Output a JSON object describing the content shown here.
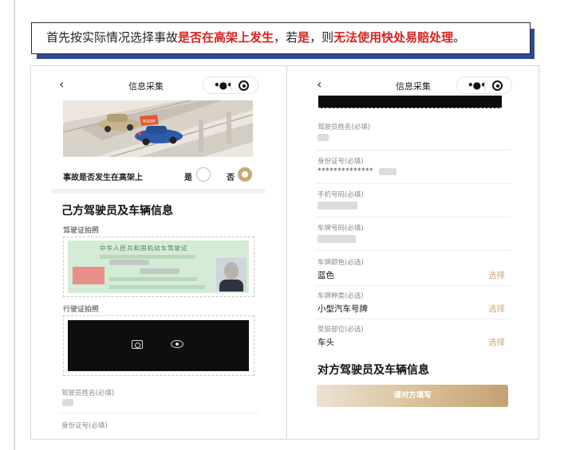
{
  "banner": {
    "part1": "首先按实际情况选择事故",
    "part2": "是否在高架上发生",
    "part3": "，若",
    "part4": "是",
    "part5": "，则",
    "part6": "无法使用快处易赔处理",
    "part7": "。"
  },
  "colors": {
    "accent_gold": "#c9a877",
    "banner_shadow": "#2e4a95",
    "highlight_red": "#d8231f"
  },
  "left_screen": {
    "nav": {
      "back_icon": "chevron-left-icon",
      "title": "信息采集",
      "more_icon": "more-dots-icon",
      "target_icon": "target-icon"
    },
    "illustration": {
      "badge_text": "BOOM"
    },
    "question": {
      "text": "事故是否发生在高架上",
      "yes": "是",
      "no": "否",
      "selected": "否"
    },
    "section_title": "己方驾驶员及车辆信息",
    "driving_license_label": "驾驶证拍照",
    "driving_license_header": "中华人民共和国机动车驾驶证",
    "vehicle_license_label": "行驶证拍照",
    "driver_name_label": "驾驶员姓名(必填)",
    "id_number_label": "身份证号(必填)"
  },
  "right_screen": {
    "nav": {
      "back_icon": "chevron-left-icon",
      "title": "信息采集",
      "more_icon": "more-dots-icon",
      "target_icon": "target-icon"
    },
    "driver_name_label": "驾驶员姓名(必填)",
    "id_number_label": "身份证号(必填)",
    "id_number_value": "**************",
    "phone_label": "手机号码(必填)",
    "plate_label": "车牌号码(必填)",
    "color_label": "车牌颜色(必选)",
    "color_value": "蓝色",
    "type_label": "车牌种类(必选)",
    "type_value": "小型汽车号牌",
    "damage_label": "受损部位(必选)",
    "damage_value": "车头",
    "select_text": "选择",
    "other_section_title": "对方驾驶员及车辆信息",
    "other_button": "请对方填写"
  }
}
